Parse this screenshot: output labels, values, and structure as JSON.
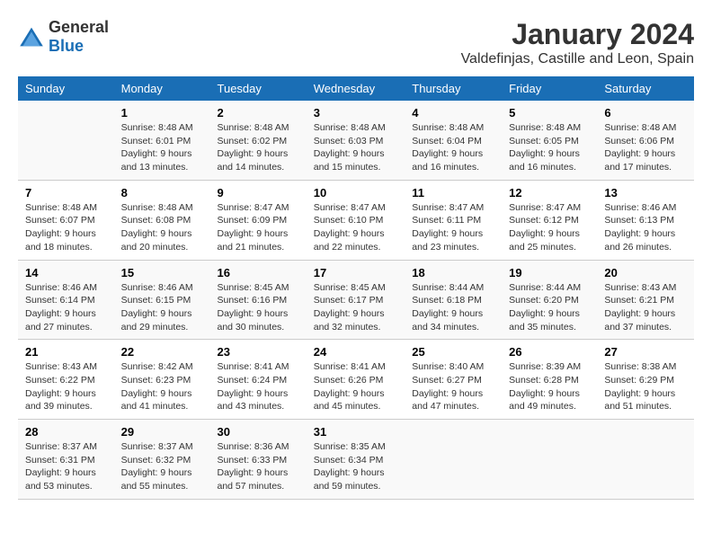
{
  "logo": {
    "general": "General",
    "blue": "Blue"
  },
  "title": "January 2024",
  "subtitle": "Valdefinjas, Castille and Leon, Spain",
  "headers": [
    "Sunday",
    "Monday",
    "Tuesday",
    "Wednesday",
    "Thursday",
    "Friday",
    "Saturday"
  ],
  "rows": [
    [
      {
        "day": "",
        "lines": []
      },
      {
        "day": "1",
        "lines": [
          "Sunrise: 8:48 AM",
          "Sunset: 6:01 PM",
          "Daylight: 9 hours",
          "and 13 minutes."
        ]
      },
      {
        "day": "2",
        "lines": [
          "Sunrise: 8:48 AM",
          "Sunset: 6:02 PM",
          "Daylight: 9 hours",
          "and 14 minutes."
        ]
      },
      {
        "day": "3",
        "lines": [
          "Sunrise: 8:48 AM",
          "Sunset: 6:03 PM",
          "Daylight: 9 hours",
          "and 15 minutes."
        ]
      },
      {
        "day": "4",
        "lines": [
          "Sunrise: 8:48 AM",
          "Sunset: 6:04 PM",
          "Daylight: 9 hours",
          "and 16 minutes."
        ]
      },
      {
        "day": "5",
        "lines": [
          "Sunrise: 8:48 AM",
          "Sunset: 6:05 PM",
          "Daylight: 9 hours",
          "and 16 minutes."
        ]
      },
      {
        "day": "6",
        "lines": [
          "Sunrise: 8:48 AM",
          "Sunset: 6:06 PM",
          "Daylight: 9 hours",
          "and 17 minutes."
        ]
      }
    ],
    [
      {
        "day": "7",
        "lines": [
          "Sunrise: 8:48 AM",
          "Sunset: 6:07 PM",
          "Daylight: 9 hours",
          "and 18 minutes."
        ]
      },
      {
        "day": "8",
        "lines": [
          "Sunrise: 8:48 AM",
          "Sunset: 6:08 PM",
          "Daylight: 9 hours",
          "and 20 minutes."
        ]
      },
      {
        "day": "9",
        "lines": [
          "Sunrise: 8:47 AM",
          "Sunset: 6:09 PM",
          "Daylight: 9 hours",
          "and 21 minutes."
        ]
      },
      {
        "day": "10",
        "lines": [
          "Sunrise: 8:47 AM",
          "Sunset: 6:10 PM",
          "Daylight: 9 hours",
          "and 22 minutes."
        ]
      },
      {
        "day": "11",
        "lines": [
          "Sunrise: 8:47 AM",
          "Sunset: 6:11 PM",
          "Daylight: 9 hours",
          "and 23 minutes."
        ]
      },
      {
        "day": "12",
        "lines": [
          "Sunrise: 8:47 AM",
          "Sunset: 6:12 PM",
          "Daylight: 9 hours",
          "and 25 minutes."
        ]
      },
      {
        "day": "13",
        "lines": [
          "Sunrise: 8:46 AM",
          "Sunset: 6:13 PM",
          "Daylight: 9 hours",
          "and 26 minutes."
        ]
      }
    ],
    [
      {
        "day": "14",
        "lines": [
          "Sunrise: 8:46 AM",
          "Sunset: 6:14 PM",
          "Daylight: 9 hours",
          "and 27 minutes."
        ]
      },
      {
        "day": "15",
        "lines": [
          "Sunrise: 8:46 AM",
          "Sunset: 6:15 PM",
          "Daylight: 9 hours",
          "and 29 minutes."
        ]
      },
      {
        "day": "16",
        "lines": [
          "Sunrise: 8:45 AM",
          "Sunset: 6:16 PM",
          "Daylight: 9 hours",
          "and 30 minutes."
        ]
      },
      {
        "day": "17",
        "lines": [
          "Sunrise: 8:45 AM",
          "Sunset: 6:17 PM",
          "Daylight: 9 hours",
          "and 32 minutes."
        ]
      },
      {
        "day": "18",
        "lines": [
          "Sunrise: 8:44 AM",
          "Sunset: 6:18 PM",
          "Daylight: 9 hours",
          "and 34 minutes."
        ]
      },
      {
        "day": "19",
        "lines": [
          "Sunrise: 8:44 AM",
          "Sunset: 6:20 PM",
          "Daylight: 9 hours",
          "and 35 minutes."
        ]
      },
      {
        "day": "20",
        "lines": [
          "Sunrise: 8:43 AM",
          "Sunset: 6:21 PM",
          "Daylight: 9 hours",
          "and 37 minutes."
        ]
      }
    ],
    [
      {
        "day": "21",
        "lines": [
          "Sunrise: 8:43 AM",
          "Sunset: 6:22 PM",
          "Daylight: 9 hours",
          "and 39 minutes."
        ]
      },
      {
        "day": "22",
        "lines": [
          "Sunrise: 8:42 AM",
          "Sunset: 6:23 PM",
          "Daylight: 9 hours",
          "and 41 minutes."
        ]
      },
      {
        "day": "23",
        "lines": [
          "Sunrise: 8:41 AM",
          "Sunset: 6:24 PM",
          "Daylight: 9 hours",
          "and 43 minutes."
        ]
      },
      {
        "day": "24",
        "lines": [
          "Sunrise: 8:41 AM",
          "Sunset: 6:26 PM",
          "Daylight: 9 hours",
          "and 45 minutes."
        ]
      },
      {
        "day": "25",
        "lines": [
          "Sunrise: 8:40 AM",
          "Sunset: 6:27 PM",
          "Daylight: 9 hours",
          "and 47 minutes."
        ]
      },
      {
        "day": "26",
        "lines": [
          "Sunrise: 8:39 AM",
          "Sunset: 6:28 PM",
          "Daylight: 9 hours",
          "and 49 minutes."
        ]
      },
      {
        "day": "27",
        "lines": [
          "Sunrise: 8:38 AM",
          "Sunset: 6:29 PM",
          "Daylight: 9 hours",
          "and 51 minutes."
        ]
      }
    ],
    [
      {
        "day": "28",
        "lines": [
          "Sunrise: 8:37 AM",
          "Sunset: 6:31 PM",
          "Daylight: 9 hours",
          "and 53 minutes."
        ]
      },
      {
        "day": "29",
        "lines": [
          "Sunrise: 8:37 AM",
          "Sunset: 6:32 PM",
          "Daylight: 9 hours",
          "and 55 minutes."
        ]
      },
      {
        "day": "30",
        "lines": [
          "Sunrise: 8:36 AM",
          "Sunset: 6:33 PM",
          "Daylight: 9 hours",
          "and 57 minutes."
        ]
      },
      {
        "day": "31",
        "lines": [
          "Sunrise: 8:35 AM",
          "Sunset: 6:34 PM",
          "Daylight: 9 hours",
          "and 59 minutes."
        ]
      },
      {
        "day": "",
        "lines": []
      },
      {
        "day": "",
        "lines": []
      },
      {
        "day": "",
        "lines": []
      }
    ]
  ]
}
